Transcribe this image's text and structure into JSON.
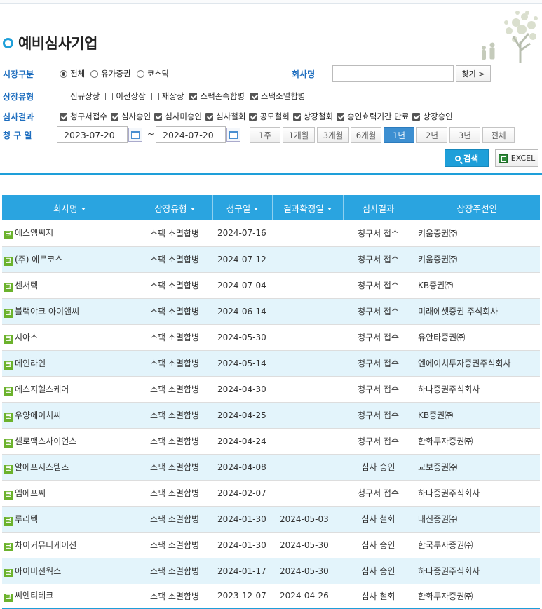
{
  "page": {
    "title": "예비심사기업"
  },
  "filters": {
    "market": {
      "label": "시장구분",
      "options": [
        {
          "label": "전체",
          "selected": true
        },
        {
          "label": "유가증권",
          "selected": false
        },
        {
          "label": "코스닥",
          "selected": false
        }
      ]
    },
    "company": {
      "label": "회사명",
      "value": "",
      "find_label": "찾기 >"
    },
    "listing_type": {
      "label": "상장유형",
      "options": [
        {
          "label": "신규상장",
          "checked": false
        },
        {
          "label": "이전상장",
          "checked": false
        },
        {
          "label": "재상장",
          "checked": false
        },
        {
          "label": "스팩존속합병",
          "checked": true
        },
        {
          "label": "스팩소멸합병",
          "checked": true
        }
      ]
    },
    "review_result": {
      "label": "심사결과",
      "options": [
        {
          "label": "청구서접수",
          "checked": true
        },
        {
          "label": "심사승인",
          "checked": true
        },
        {
          "label": "심사미승인",
          "checked": true
        },
        {
          "label": "심사철회",
          "checked": true
        },
        {
          "label": "공모철회",
          "checked": true
        },
        {
          "label": "상장철회",
          "checked": true
        },
        {
          "label": "승인효력기간 만료",
          "checked": true
        },
        {
          "label": "상장승인",
          "checked": true
        }
      ]
    },
    "request_date": {
      "label": "청 구 일",
      "from": "2023-07-20",
      "to": "2024-07-20",
      "separator": "~",
      "periods": [
        {
          "label": "1주",
          "active": false
        },
        {
          "label": "1개월",
          "active": false
        },
        {
          "label": "3개월",
          "active": false
        },
        {
          "label": "6개월",
          "active": false
        },
        {
          "label": "1년",
          "active": true
        },
        {
          "label": "2년",
          "active": false
        },
        {
          "label": "3년",
          "active": false
        },
        {
          "label": "전체",
          "active": false
        }
      ]
    }
  },
  "actions": {
    "search_label": "검색",
    "excel_label": "EXCEL"
  },
  "table": {
    "columns": [
      "회사명",
      "상장유형",
      "청구일",
      "결과확정일",
      "심사결과",
      "상장주선인"
    ],
    "market_icon_text": "코",
    "rows": [
      {
        "company": "에스엠씨지",
        "type": "스팩 소멸합병",
        "request_date": "2024-07-16",
        "confirm_date": "",
        "result": "청구서 접수",
        "underwriter": "키움증권㈜"
      },
      {
        "company": "(주) 에르코스",
        "type": "스팩 소멸합병",
        "request_date": "2024-07-12",
        "confirm_date": "",
        "result": "청구서 접수",
        "underwriter": "키움증권㈜"
      },
      {
        "company": "센서텍",
        "type": "스팩 소멸합병",
        "request_date": "2024-07-04",
        "confirm_date": "",
        "result": "청구서 접수",
        "underwriter": "KB증권㈜"
      },
      {
        "company": "블랙야크 아이앤씨",
        "type": "스팩 소멸합병",
        "request_date": "2024-06-14",
        "confirm_date": "",
        "result": "청구서 접수",
        "underwriter": "미래에셋증권 주식회사"
      },
      {
        "company": "시아스",
        "type": "스팩 소멸합병",
        "request_date": "2024-05-30",
        "confirm_date": "",
        "result": "청구서 접수",
        "underwriter": "유안타증권㈜"
      },
      {
        "company": "메인라인",
        "type": "스팩 소멸합병",
        "request_date": "2024-05-14",
        "confirm_date": "",
        "result": "청구서 접수",
        "underwriter": "엔에이치투자증권주식회사"
      },
      {
        "company": "에스지헬스케어",
        "type": "스팩 소멸합병",
        "request_date": "2024-04-30",
        "confirm_date": "",
        "result": "청구서 접수",
        "underwriter": "하나증권주식회사"
      },
      {
        "company": "우양에이치씨",
        "type": "스팩 소멸합병",
        "request_date": "2024-04-25",
        "confirm_date": "",
        "result": "청구서 접수",
        "underwriter": "KB증권㈜"
      },
      {
        "company": "셀로맥스사이언스",
        "type": "스팩 소멸합병",
        "request_date": "2024-04-24",
        "confirm_date": "",
        "result": "청구서 접수",
        "underwriter": "한화투자증권㈜"
      },
      {
        "company": "알에프시스템즈",
        "type": "스팩 소멸합병",
        "request_date": "2024-04-08",
        "confirm_date": "",
        "result": "심사 승인",
        "underwriter": "교보증권㈜"
      },
      {
        "company": "엠에프씨",
        "type": "스팩 소멸합병",
        "request_date": "2024-02-07",
        "confirm_date": "",
        "result": "청구서 접수",
        "underwriter": "하나증권주식회사"
      },
      {
        "company": "루리텍",
        "type": "스팩 소멸합병",
        "request_date": "2024-01-30",
        "confirm_date": "2024-05-03",
        "result": "심사 철회",
        "underwriter": "대신증권㈜"
      },
      {
        "company": "차이커뮤니케이션",
        "type": "스팩 소멸합병",
        "request_date": "2024-01-30",
        "confirm_date": "2024-05-30",
        "result": "심사 승인",
        "underwriter": "한국투자증권㈜"
      },
      {
        "company": "아이비젼웍스",
        "type": "스팩 소멸합병",
        "request_date": "2024-01-17",
        "confirm_date": "2024-05-30",
        "result": "심사 승인",
        "underwriter": "하나증권주식회사"
      },
      {
        "company": "씨엔티테크",
        "type": "스팩 소멸합병",
        "request_date": "2023-12-07",
        "confirm_date": "2024-04-26",
        "result": "심사 철회",
        "underwriter": "한화투자증권㈜"
      }
    ]
  }
}
